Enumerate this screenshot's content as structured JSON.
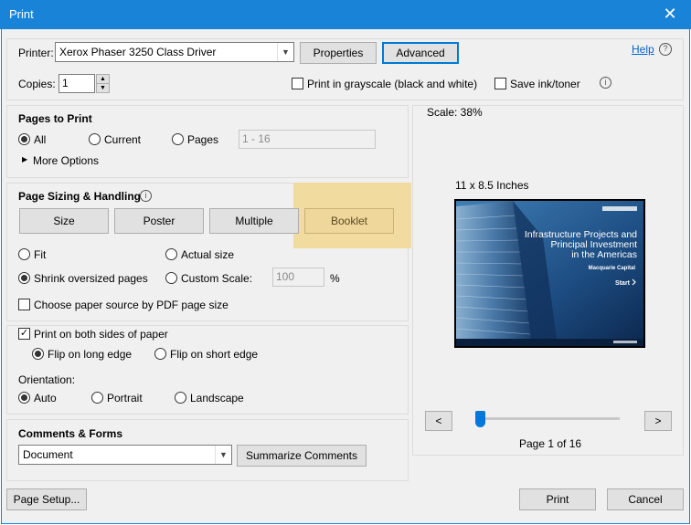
{
  "window": {
    "title": "Print",
    "close_glyph": "✕"
  },
  "printer": {
    "label": "Printer:",
    "selected": "Xerox Phaser 3250 Class Driver",
    "properties_label": "Properties",
    "advanced_label": "Advanced",
    "help_label": "Help",
    "help_glyph": "?"
  },
  "copies": {
    "label": "Copies:",
    "value": "1",
    "grayscale_label": "Print in grayscale (black and white)",
    "save_ink_label": "Save ink/toner",
    "info_glyph": "i"
  },
  "pages_to_print": {
    "heading": "Pages to Print",
    "all_label": "All",
    "current_label": "Current",
    "pages_label": "Pages",
    "range_value": "1 - 16",
    "more_options_label": "More Options",
    "selected": "All"
  },
  "page_sizing": {
    "heading": "Page Sizing & Handling",
    "tabs": [
      "Size",
      "Poster",
      "Multiple",
      "Booklet"
    ],
    "active_tab": "Booklet",
    "fit_label": "Fit",
    "actual_size_label": "Actual size",
    "shrink_label": "Shrink oversized pages",
    "custom_scale_label": "Custom Scale:",
    "custom_scale_value": "100",
    "percent_label": "%",
    "paper_source_label": "Choose paper source by PDF page size",
    "selected": "Shrink oversized pages",
    "highlight_color": "#f2d791"
  },
  "duplex": {
    "both_sides_label": "Print on both sides of paper",
    "both_sides_checked": true,
    "long_edge_label": "Flip on long edge",
    "short_edge_label": "Flip on short edge",
    "selected": "Flip on long edge"
  },
  "orientation": {
    "label": "Orientation:",
    "auto_label": "Auto",
    "portrait_label": "Portrait",
    "landscape_label": "Landscape",
    "selected": "Auto"
  },
  "comments_forms": {
    "heading": "Comments & Forms",
    "selected": "Document",
    "summarize_label": "Summarize Comments"
  },
  "preview": {
    "scale_label": "Scale:  38%",
    "paper_size_label": "11 x 8.5 Inches",
    "doc_title_line1": "Infrastructure Projects and",
    "doc_title_line2": "Principal Investment",
    "doc_title_line3": "in the Americas",
    "doc_company": "Macquarie Capital",
    "doc_start": "Start",
    "prev_glyph": "<",
    "next_glyph": ">",
    "page_indicator": "Page 1 of 16",
    "current_page": 1,
    "total_pages": 16
  },
  "footer": {
    "page_setup_label": "Page Setup...",
    "print_label": "Print",
    "cancel_label": "Cancel"
  },
  "colors": {
    "titlebar": "#1883d7",
    "accent": "#0078d7"
  }
}
